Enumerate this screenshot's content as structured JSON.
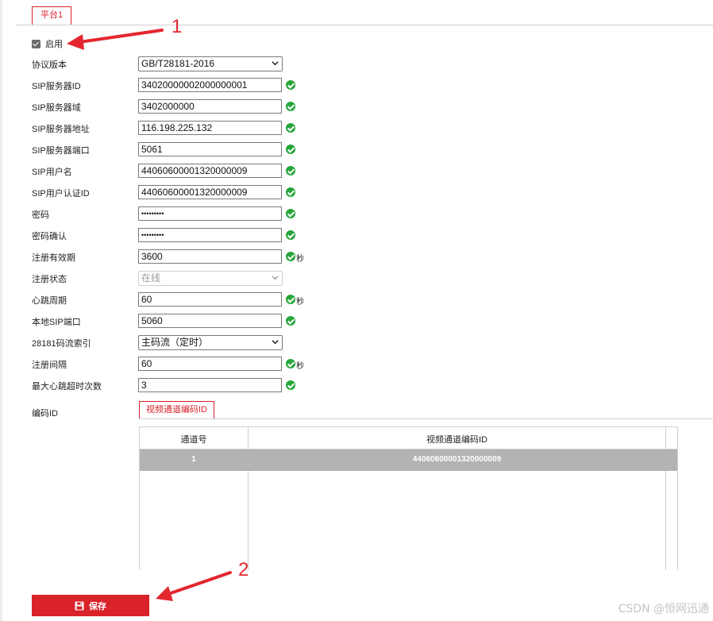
{
  "platform_tab": "平台1",
  "enable": {
    "label": "启用",
    "checked": true
  },
  "fields": [
    {
      "label": "协议版本",
      "value": "GB/T28181-2016",
      "type": "select"
    },
    {
      "label": "SIP服务器ID",
      "value": "34020000002000000001",
      "type": "text",
      "valid": true
    },
    {
      "label": "SIP服务器域",
      "value": "3402000000",
      "type": "text",
      "valid": true
    },
    {
      "label": "SIP服务器地址",
      "value": "116.198.225.132",
      "type": "text",
      "valid": true
    },
    {
      "label": "SIP服务器端口",
      "value": "5061",
      "type": "text",
      "valid": true
    },
    {
      "label": "SIP用户名",
      "value": "44060600001320000009",
      "type": "text",
      "valid": true
    },
    {
      "label": "SIP用户认证ID",
      "value": "44060600001320000009",
      "type": "text",
      "valid": true
    },
    {
      "label": "密码",
      "value": "•••••••••",
      "type": "password",
      "valid": true
    },
    {
      "label": "密码确认",
      "value": "•••••••••",
      "type": "password",
      "valid": true
    },
    {
      "label": "注册有效期",
      "value": "3600",
      "type": "text",
      "valid": true,
      "unit": "秒"
    },
    {
      "label": "注册状态",
      "value": "在线",
      "type": "select-disabled"
    },
    {
      "label": "心跳周期",
      "value": "60",
      "type": "text",
      "valid": true,
      "unit": "秒"
    },
    {
      "label": "本地SIP端口",
      "value": "5060",
      "type": "text",
      "valid": true
    },
    {
      "label": "28181码流索引",
      "value": "主码流（定时）",
      "type": "select"
    },
    {
      "label": "注册间隔",
      "value": "60",
      "type": "text",
      "valid": true,
      "unit": "秒"
    },
    {
      "label": "最大心跳超时次数",
      "value": "3",
      "type": "text",
      "valid": true
    }
  ],
  "encode": {
    "label": "编码ID",
    "tab": "视频通道编码ID",
    "columns": [
      "通道号",
      "视频通道编码ID"
    ],
    "rows": [
      {
        "channel": "1",
        "code_id": "44060600001320000009"
      }
    ]
  },
  "save_button": "保存",
  "annotations": [
    "1",
    "2"
  ],
  "watermark": "CSDN @恒网迅通",
  "colors": {
    "accent": "#d9222a",
    "valid": "#26a63a",
    "arrow": "#e3262e",
    "selected_row": "#b3b3b3"
  }
}
